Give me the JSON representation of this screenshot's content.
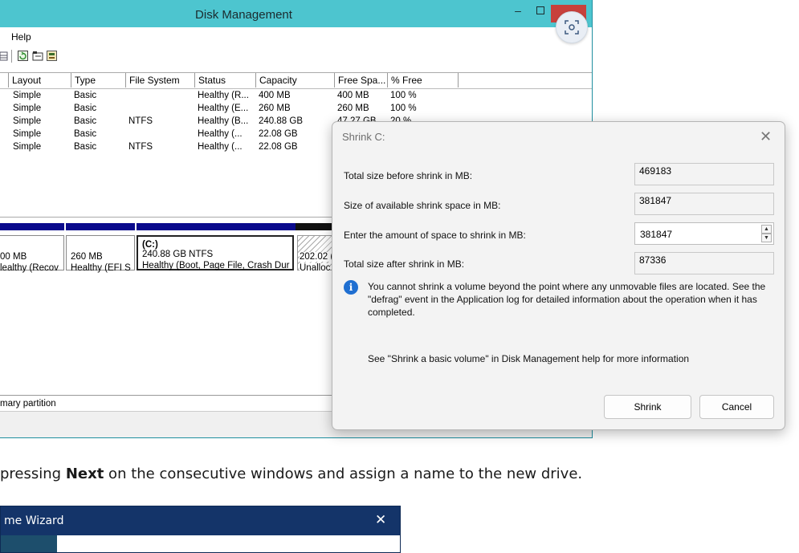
{
  "dm": {
    "title": "Disk Management",
    "menu": [
      "Help"
    ],
    "columns": [
      "Layout",
      "Type",
      "File System",
      "Status",
      "Capacity",
      "Free Spa...",
      "% Free"
    ],
    "rows": [
      {
        "layout": "Simple",
        "type": "Basic",
        "fs": "",
        "status": "Healthy (R...",
        "capacity": "400 MB",
        "free": "400 MB",
        "pct": "100 %"
      },
      {
        "layout": "Simple",
        "type": "Basic",
        "fs": "",
        "status": "Healthy (E...",
        "capacity": "260 MB",
        "free": "260 MB",
        "pct": "100 %"
      },
      {
        "layout": "Simple",
        "type": "Basic",
        "fs": "NTFS",
        "status": "Healthy (B...",
        "capacity": "240.88 GB",
        "free": "47.27 GB",
        "pct": "20 %"
      },
      {
        "layout": "Simple",
        "type": "Basic",
        "fs": "",
        "status": "Healthy (...",
        "capacity": "22.08 GB",
        "free": "",
        "pct": ""
      },
      {
        "layout": "Simple",
        "type": "Basic",
        "fs": "NTFS",
        "status": "Healthy (...",
        "capacity": "22.08 GB",
        "free": "",
        "pct": ""
      }
    ],
    "partitions": [
      {
        "label": "",
        "line1": "00 MB",
        "line2": "lealthy (Recov"
      },
      {
        "label": "",
        "line1": "260 MB",
        "line2": "Healthy (EFI S"
      },
      {
        "label": "(C:)",
        "line1": "240.88 GB NTFS",
        "line2": "Healthy (Boot, Page File, Crash Dur"
      },
      {
        "label": "",
        "line1": "202.02 (",
        "line2": "Unalloc"
      }
    ],
    "legend": "mary partition",
    "colors": {
      "titlebar": "#4dc5cf",
      "primary_bar": "#0a0a8c",
      "unallocated_bar": "#111111",
      "close": "#c8413c"
    }
  },
  "shrink": {
    "title": "Shrink C:",
    "labels": {
      "total_before": "Total size before shrink in MB:",
      "available": "Size of available shrink space in MB:",
      "amount": "Enter the amount of space to shrink in MB:",
      "total_after": "Total size after shrink in MB:"
    },
    "values": {
      "total_before": "469183",
      "available": "381847",
      "amount": "381847",
      "total_after": "87336"
    },
    "info": "You cannot shrink a volume beyond the point where any unmovable files are located. See the \"defrag\" event in the Application log for detailed information about the operation when it has completed.",
    "help": "See \"Shrink a basic volume\" in Disk Management help for more information",
    "shrink_btn": "Shrink",
    "cancel_btn": "Cancel"
  },
  "article": {
    "pre": "pressing ",
    "bold": "Next",
    "post": " on the consecutive windows and assign a name to the new drive."
  },
  "wizard": {
    "title": "me Wizard"
  }
}
